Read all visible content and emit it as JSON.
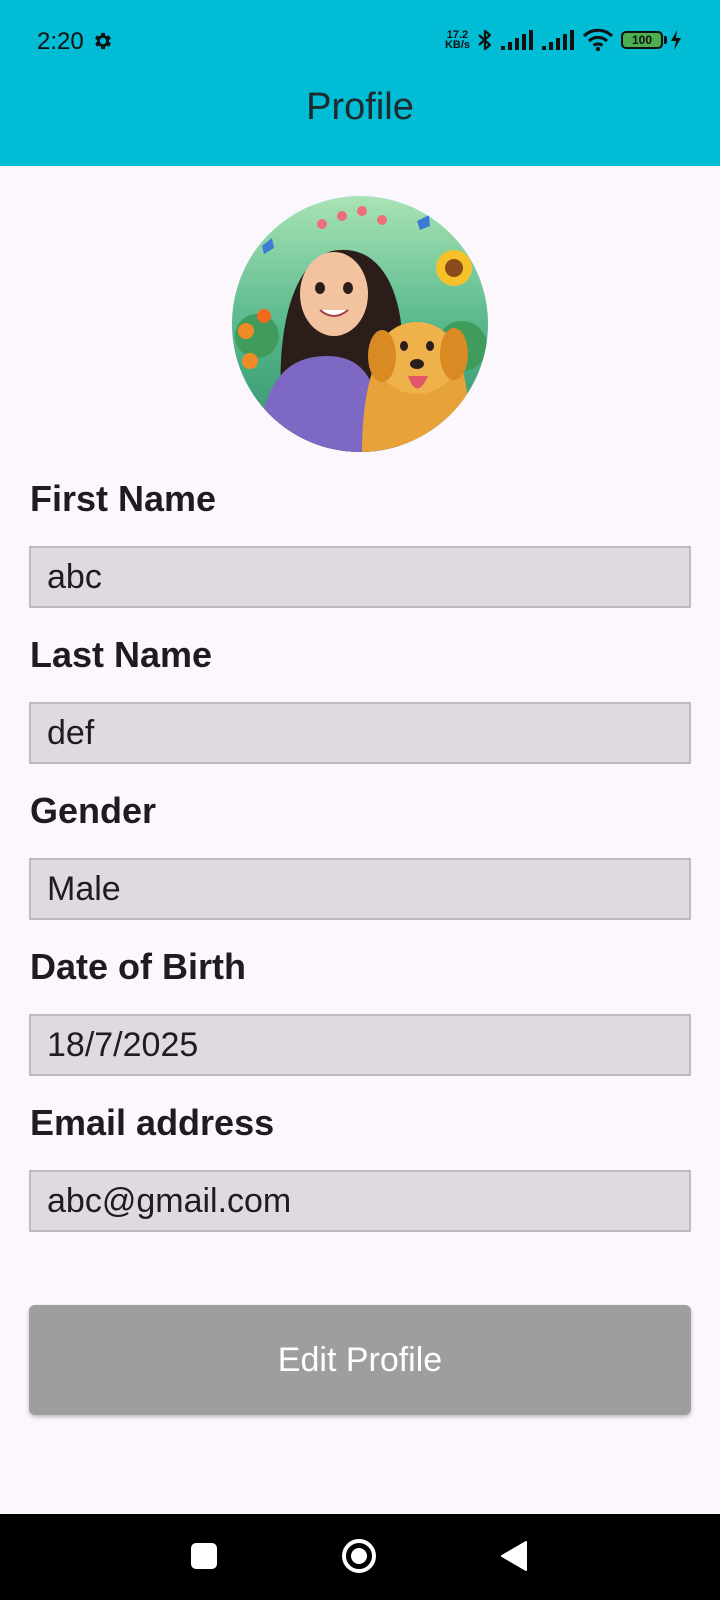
{
  "status_bar": {
    "time": "2:20",
    "net_speed_value": "17.2",
    "net_speed_unit": "KB/s",
    "battery": "100",
    "icons": [
      "settings-gear-icon",
      "bluetooth-icon",
      "signal-icon",
      "signal-icon",
      "wifi-icon",
      "battery-icon",
      "charging-icon"
    ]
  },
  "header": {
    "title": "Profile"
  },
  "profile": {
    "avatar_icon": "profile-avatar-image",
    "fields": [
      {
        "label": "First Name",
        "value": "abc"
      },
      {
        "label": "Last Name",
        "value": "def"
      },
      {
        "label": "Gender",
        "value": "Male"
      },
      {
        "label": "Date of Birth",
        "value": "18/7/2025"
      },
      {
        "label": "Email address",
        "value": "abc@gmail.com"
      }
    ],
    "edit_button_label": "Edit Profile"
  },
  "colors": {
    "header_bg": "#00bcd4",
    "page_bg": "#fcf7fc",
    "field_bg": "#dedadf",
    "button_bg": "#9e9e9e",
    "battery_fill": "#4caf50"
  },
  "nav_bar": {
    "icons": [
      "recents-icon",
      "home-icon",
      "back-icon"
    ]
  }
}
